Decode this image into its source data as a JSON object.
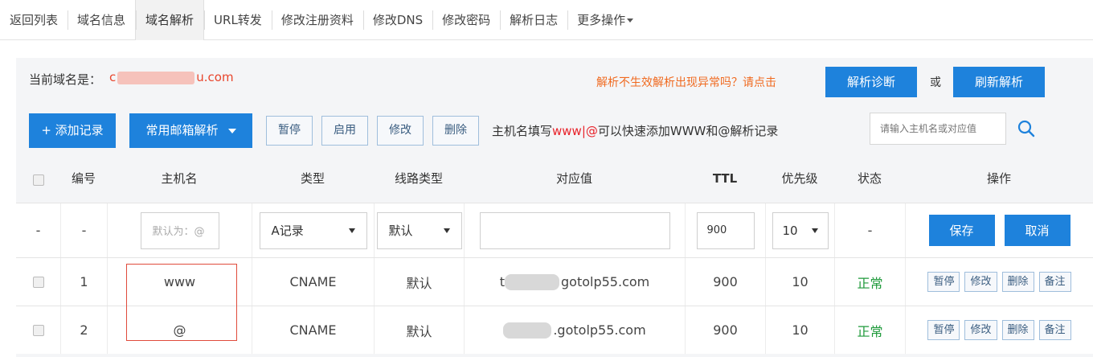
{
  "tabs": [
    {
      "label": "返回列表"
    },
    {
      "label": "域名信息"
    },
    {
      "label": "域名解析"
    },
    {
      "label": "URL转发"
    },
    {
      "label": "修改注册资料"
    },
    {
      "label": "修改DNS"
    },
    {
      "label": "修改密码"
    },
    {
      "label": "解析日志"
    },
    {
      "label": "更多操作"
    }
  ],
  "domain_bar": {
    "label": "当前域名是：",
    "value_prefix": "c",
    "value_suffix": "u.com",
    "diag_tip": "解析不生效解析出现异常吗？请点击",
    "diag_button": "解析诊断",
    "or_text": "或",
    "refresh_button": "刷新解析"
  },
  "toolbar": {
    "add_record": "+ 添加记录",
    "mail_resolve": "常用邮箱解析",
    "pause": "暂停",
    "enable": "启用",
    "modify": "修改",
    "delete": "删除",
    "tip_prefix": "主机名填写",
    "tip_red": "www|@",
    "tip_suffix": "可以快速添加WWW和@解析记录",
    "search_placeholder": "请输入主机名或对应值"
  },
  "table": {
    "headers": {
      "number": "编号",
      "host": "主机名",
      "type": "类型",
      "line": "线路类型",
      "value": "对应值",
      "ttl": "TTL",
      "priority": "优先级",
      "status": "状态",
      "action": "操作"
    },
    "edit_row": {
      "check": "-",
      "number": "-",
      "host_placeholder": "默认为：@",
      "type": "A记录",
      "line": "默认",
      "value": "",
      "ttl": "900",
      "priority": "10",
      "status": "-",
      "save": "保存",
      "cancel": "取消"
    },
    "rows": [
      {
        "number": "1",
        "host": "www",
        "type": "CNAME",
        "line": "默认",
        "value_prefix": "t",
        "value_suffix": "gotolp55.com",
        "ttl": "900",
        "priority": "10",
        "status": "正常"
      },
      {
        "number": "2",
        "host": "@",
        "type": "CNAME",
        "line": "默认",
        "value_prefix": "",
        "value_suffix": ".gotolp55.com",
        "ttl": "900",
        "priority": "10",
        "status": "正常"
      }
    ],
    "row_actions": {
      "pause": "暂停",
      "modify": "修改",
      "delete": "删除",
      "note": "备注"
    }
  },
  "colors": {
    "primary": "#1e82dc",
    "warning_text": "#f06a20",
    "domain_text": "#e8452c",
    "status_ok": "#1f9a3b",
    "highlight": "#e04b3c"
  }
}
